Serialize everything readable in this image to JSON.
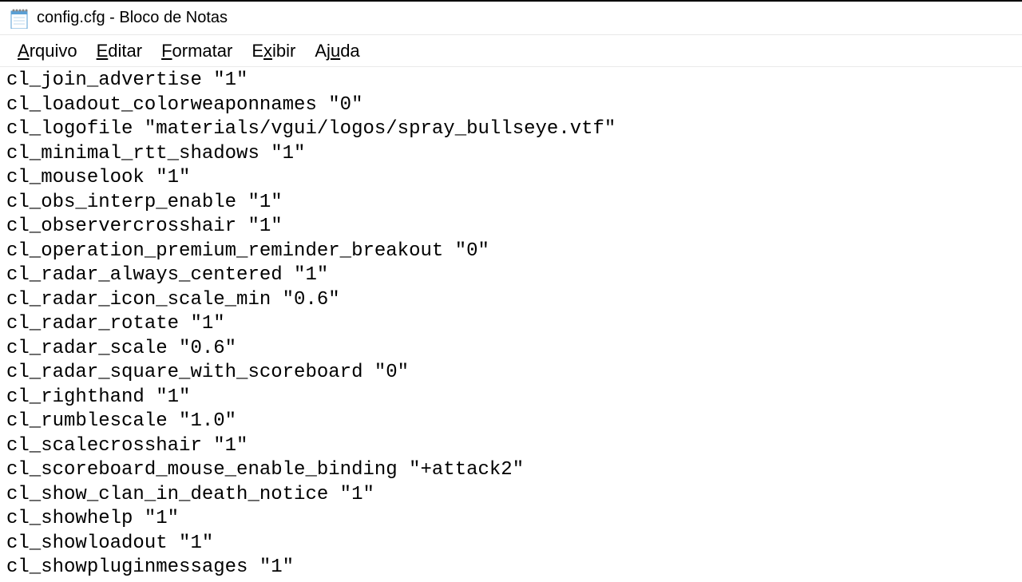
{
  "titlebar": {
    "title": "config.cfg - Bloco de Notas"
  },
  "menubar": {
    "items": [
      {
        "label": "Arquivo",
        "underline_index": 0
      },
      {
        "label": "Editar",
        "underline_index": 0
      },
      {
        "label": "Formatar",
        "underline_index": 0
      },
      {
        "label": "Exibir",
        "underline_index": 1
      },
      {
        "label": "Ajuda",
        "underline_index": 2
      }
    ]
  },
  "content": {
    "lines": [
      "cl_join_advertise \"1\"",
      "cl_loadout_colorweaponnames \"0\"",
      "cl_logofile \"materials/vgui/logos/spray_bullseye.vtf\"",
      "cl_minimal_rtt_shadows \"1\"",
      "cl_mouselook \"1\"",
      "cl_obs_interp_enable \"1\"",
      "cl_observercrosshair \"1\"",
      "cl_operation_premium_reminder_breakout \"0\"",
      "cl_radar_always_centered \"1\"",
      "cl_radar_icon_scale_min \"0.6\"",
      "cl_radar_rotate \"1\"",
      "cl_radar_scale \"0.6\"",
      "cl_radar_square_with_scoreboard \"0\"",
      "cl_righthand \"1\"",
      "cl_rumblescale \"1.0\"",
      "cl_scalecrosshair \"1\"",
      "cl_scoreboard_mouse_enable_binding \"+attack2\"",
      "cl_show_clan_in_death_notice \"1\"",
      "cl_showhelp \"1\"",
      "cl_showloadout \"1\"",
      "cl_showpluginmessages \"1\""
    ]
  }
}
